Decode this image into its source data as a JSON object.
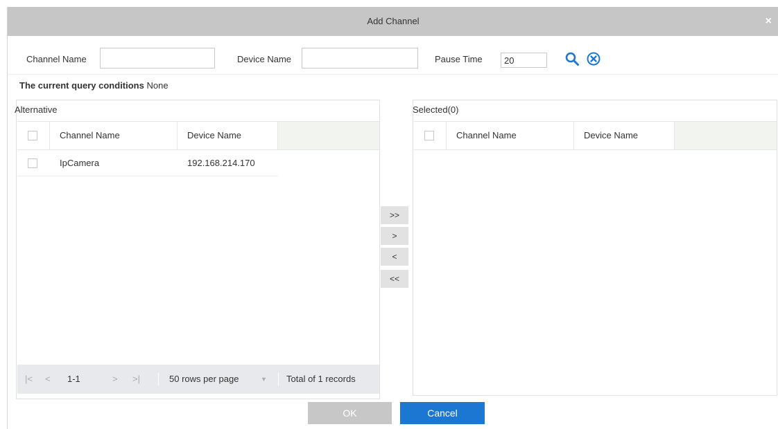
{
  "dialog": {
    "title": "Add Channel",
    "close_glyph": "×"
  },
  "filters": {
    "channel_name_label": "Channel Name",
    "channel_name_value": "",
    "device_name_label": "Device Name",
    "device_name_value": "",
    "pause_time_label": "Pause Time",
    "pause_time_value": "20",
    "search_icon": "search-icon",
    "clear_icon": "clear-circle-icon"
  },
  "query": {
    "label": "The current query conditions",
    "value": "None"
  },
  "alternative": {
    "title": "Alternative",
    "columns": [
      "Channel Name",
      "Device Name"
    ],
    "rows": [
      {
        "channel": "IpCamera",
        "device": "192.168.214.170"
      }
    ],
    "pager": {
      "first": "|<",
      "prev": "<",
      "range": "1-1",
      "next": ">",
      "last": ">|",
      "rows_per_page": "50 rows per page",
      "dropdown_glyph": "▼",
      "total": "Total of 1 records"
    }
  },
  "selected": {
    "title": "Selected(0)",
    "columns": [
      "Channel Name",
      "Device Name"
    ]
  },
  "movers": {
    "add_all": ">>",
    "add": ">",
    "remove": "<",
    "remove_all": "<<"
  },
  "buttons": {
    "ok": "OK",
    "cancel": "Cancel"
  },
  "colors": {
    "titlebar": "#c6c6c6",
    "accent": "#1b77d2",
    "ok_disabled": "#c7c7c7",
    "pager_bg": "#e8e9ec"
  }
}
